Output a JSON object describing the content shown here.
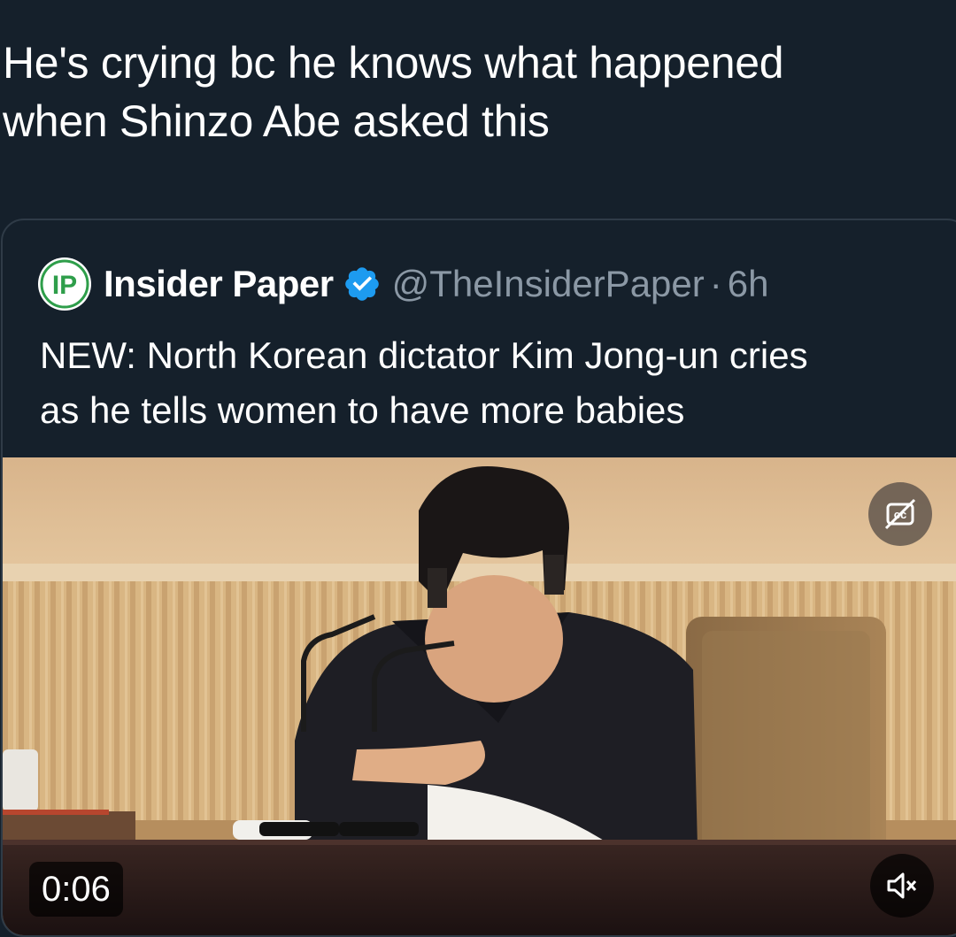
{
  "tweet": {
    "text_line1": "He's crying bc he knows what happened",
    "text_line2": "when Shinzo Abe asked this"
  },
  "quoted_tweet": {
    "avatar_text": "IP",
    "author_name": "Insider Paper",
    "verified_icon": "verified-badge-icon",
    "handle": "@TheInsiderPaper",
    "separator": "·",
    "time": "6h",
    "text_line1": "NEW: North Korean dictator Kim Jong-un cries",
    "text_line2": "as he tells women to have more babies",
    "media": {
      "duration": "0:06",
      "cc_icon": "captions-off-icon",
      "mute_icon": "speaker-muted-icon"
    }
  },
  "colors": {
    "background": "#15202b",
    "secondary_text": "#8b98a5",
    "verified_blue": "#1d9bf0",
    "avatar_green": "#2e9e4a"
  }
}
